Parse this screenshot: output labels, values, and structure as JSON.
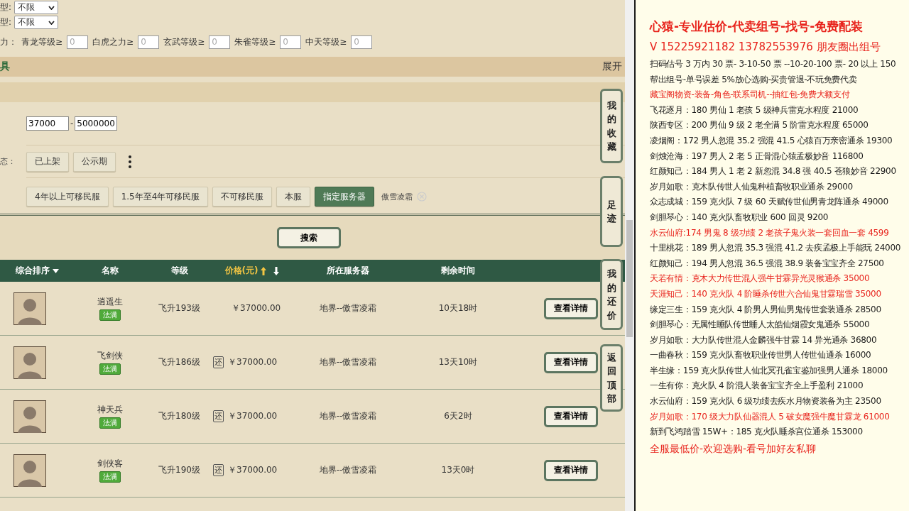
{
  "filters": {
    "selects": [
      {
        "label": "型:",
        "value": "不限"
      },
      {
        "label": "型:",
        "value": "不限"
      }
    ],
    "levels": {
      "label": "力：",
      "items": [
        {
          "label": "青龙等级≥",
          "placeholder": "0"
        },
        {
          "label": "白虎之力≥",
          "placeholder": "0"
        },
        {
          "label": "玄武等级≥",
          "placeholder": "0"
        },
        {
          "label": "朱雀等级≥",
          "placeholder": "0"
        },
        {
          "label": "中天等级≥",
          "placeholder": "0"
        }
      ]
    }
  },
  "section_bar": {
    "title": "具",
    "toggle": "展开"
  },
  "price_range": {
    "min": "37000",
    "separator": "-",
    "max": "5000000"
  },
  "status": {
    "label": "态：",
    "options": [
      {
        "label": "已上架",
        "selected": false
      },
      {
        "label": "公示期",
        "selected": false
      }
    ]
  },
  "servers": {
    "options": [
      {
        "label": "4年以上可移民服",
        "selected": false
      },
      {
        "label": "1.5年至4年可移民服",
        "selected": false
      },
      {
        "label": "不可移民服",
        "selected": false
      },
      {
        "label": "本服",
        "selected": false
      },
      {
        "label": "指定服务器",
        "selected": true
      }
    ],
    "chosen": "傲雪凌霜"
  },
  "search_button": "搜索",
  "table": {
    "columns": [
      {
        "label": "综合排序",
        "kind": "dropdown",
        "selected": false
      },
      {
        "label": "名称",
        "kind": "plain",
        "selected": false
      },
      {
        "label": "等级",
        "kind": "plain",
        "selected": false
      },
      {
        "label": "价格(元)",
        "kind": "sort",
        "selected": true
      },
      {
        "label": "所在服务器",
        "kind": "plain",
        "selected": false
      },
      {
        "label": "剩余时间",
        "kind": "plain",
        "selected": false
      }
    ],
    "rows": [
      {
        "name": "逍遥生",
        "tag": "法满",
        "level": "飞升193级",
        "price": "￥37000.00",
        "server": "地界--傲雪凌霜",
        "time": "10天18时",
        "action": "查看详情"
      },
      {
        "name": "飞剑侠",
        "tag": "法满",
        "level": "飞升186级",
        "counter": "还",
        "price": "￥37000.00",
        "server": "地界--傲雪凌霜",
        "time": "13天10时",
        "action": "查看详情"
      },
      {
        "name": "神天兵",
        "tag": "法满",
        "level": "飞升180级",
        "counter": "还",
        "price": "￥37000.00",
        "server": "地界--傲雪凌霜",
        "time": "6天2时",
        "action": "查看详情"
      },
      {
        "name": "剑侠客",
        "tag": "法满",
        "level": "飞升190级",
        "counter": "还",
        "price": "￥37000.00",
        "server": "地界--傲雪凌霜",
        "time": "13天0时",
        "action": "查看详情"
      }
    ]
  },
  "side_tabs": [
    "我的收藏",
    "足迹",
    "我的还价",
    "返回顶部"
  ],
  "document": {
    "lines": [
      {
        "kind": "heading",
        "color": "#e8231c",
        "text": "心猿-专业估价-代卖组号-找号-免费配装"
      },
      {
        "kind": "contact",
        "color": "#e8231c",
        "text": "V 15225921182   13782553976 朋友圈出组号"
      },
      {
        "kind": "line",
        "color": "#1a1a1a",
        "text": "扫码估号 3 万内 30 票- 3-10-50 票  --10-20-100 票- 20 以上 150"
      },
      {
        "kind": "line",
        "color": "#1a1a1a",
        "text": "帮出组号-单号误差 5%放心选购-买贵管退-不玩免费代卖"
      },
      {
        "kind": "line",
        "color": "#e8231c",
        "text": "藏宝阁物资-装备-角色-联系司机--抽红包-免费大额支付"
      },
      {
        "kind": "line",
        "color": "#1a1a1a",
        "text": "飞花逐月：180 男仙 1 老孩 5 级神兵雷克水程度 21000"
      },
      {
        "kind": "line",
        "color": "#1a1a1a",
        "text": "陕西专区：200 男仙 9 级 2 老全满 5 阶雷克水程度 65000"
      },
      {
        "kind": "line",
        "color": "#1a1a1a",
        "text": "凌烟阁：172 男人忽混 35.2 强混 41.5 心猿百万亲密通杀 19300"
      },
      {
        "kind": "line",
        "color": "#1a1a1a",
        "text": "剑烛沧海：197 男人 2 老 5 正骨混心猿孟极妙音 116800"
      },
      {
        "kind": "line",
        "color": "#1a1a1a",
        "text": "红颜知己：184 男人 1 老 2 新忽混 34.8 强 40.5 苍狼妙音 22900"
      },
      {
        "kind": "line",
        "color": "#1a1a1a",
        "text": "岁月如歌：克木队传世人仙鬼种植畜牧职业通杀 29000"
      },
      {
        "kind": "line",
        "color": "#1a1a1a",
        "text": "众志成城：159 克火队 7 级 60 天赋传世仙男青龙阵通杀 49000"
      },
      {
        "kind": "line",
        "color": "#1a1a1a",
        "text": "剑胆琴心：140 克火队畜牧职业 600 回灵 9200"
      },
      {
        "kind": "line",
        "color": "#e8231c",
        "text": "水云仙府:174 男鬼 8 级功绩 2 老孩子鬼火装一套回血一套 4599"
      },
      {
        "kind": "line",
        "color": "#1a1a1a",
        "text": "十里桃花：189 男人忽混 35.3 强混 41.2 去疾孟极上手能玩 24000"
      },
      {
        "kind": "line",
        "color": "#1a1a1a",
        "text": "红颜知己：194 男人忽混 36.5 强混 38.9 装备宝宝齐全 27500"
      },
      {
        "kind": "line",
        "color": "#e8231c",
        "text": "天若有情：克木大力传世混人强牛甘霖异光灵猴通杀 35000"
      },
      {
        "kind": "line",
        "color": "#e8231c",
        "text": "天涯知己：140 克火队 4 阶睡杀传世六合仙鬼甘霖瑞雪 35000"
      },
      {
        "kind": "line",
        "color": "#1a1a1a",
        "text": "缘定三生：159 克火队 4 阶男人男仙男鬼传世套装通杀 28500"
      },
      {
        "kind": "line",
        "color": "#1a1a1a",
        "text": "剑胆琴心：无属性睡队传世睡人太皓仙烟霞女鬼通杀 55000"
      },
      {
        "kind": "line",
        "color": "#1a1a1a",
        "text": "岁月如歌：大力队传世混人金麟强牛甘霖 14 异光通杀 36800"
      },
      {
        "kind": "line",
        "color": "#1a1a1a",
        "text": "一曲春秋：159 克火队畜牧职业传世男人传世仙通杀 16000"
      },
      {
        "kind": "line",
        "color": "#1a1a1a",
        "text": "半生缘：159 克火队传世人仙北冥孔雀宝鉴加强男人通杀 18000"
      },
      {
        "kind": "line",
        "color": "#1a1a1a",
        "text": "一生有你：克火队 4 阶混人装备宝宝齐全上手盈利 21000"
      },
      {
        "kind": "line",
        "color": "#1a1a1a",
        "text": "水云仙府：159 克火队 6 级功绩去疾水月物资装备为主 23500"
      },
      {
        "kind": "line",
        "color": "#e8231c",
        "text": "岁月如歌：170 级大力队仙器混人 5 破女魔强牛魔甘霖龙 61000"
      },
      {
        "kind": "line",
        "color": "#1a1a1a",
        "text": "新到飞鸿踏雪 15W+：185 克火队睡杀宫位通杀 153000"
      },
      {
        "kind": "closing",
        "color": "#e8231c",
        "text": "全服最低价-欢迎选购-看号加好友私聊"
      }
    ]
  }
}
